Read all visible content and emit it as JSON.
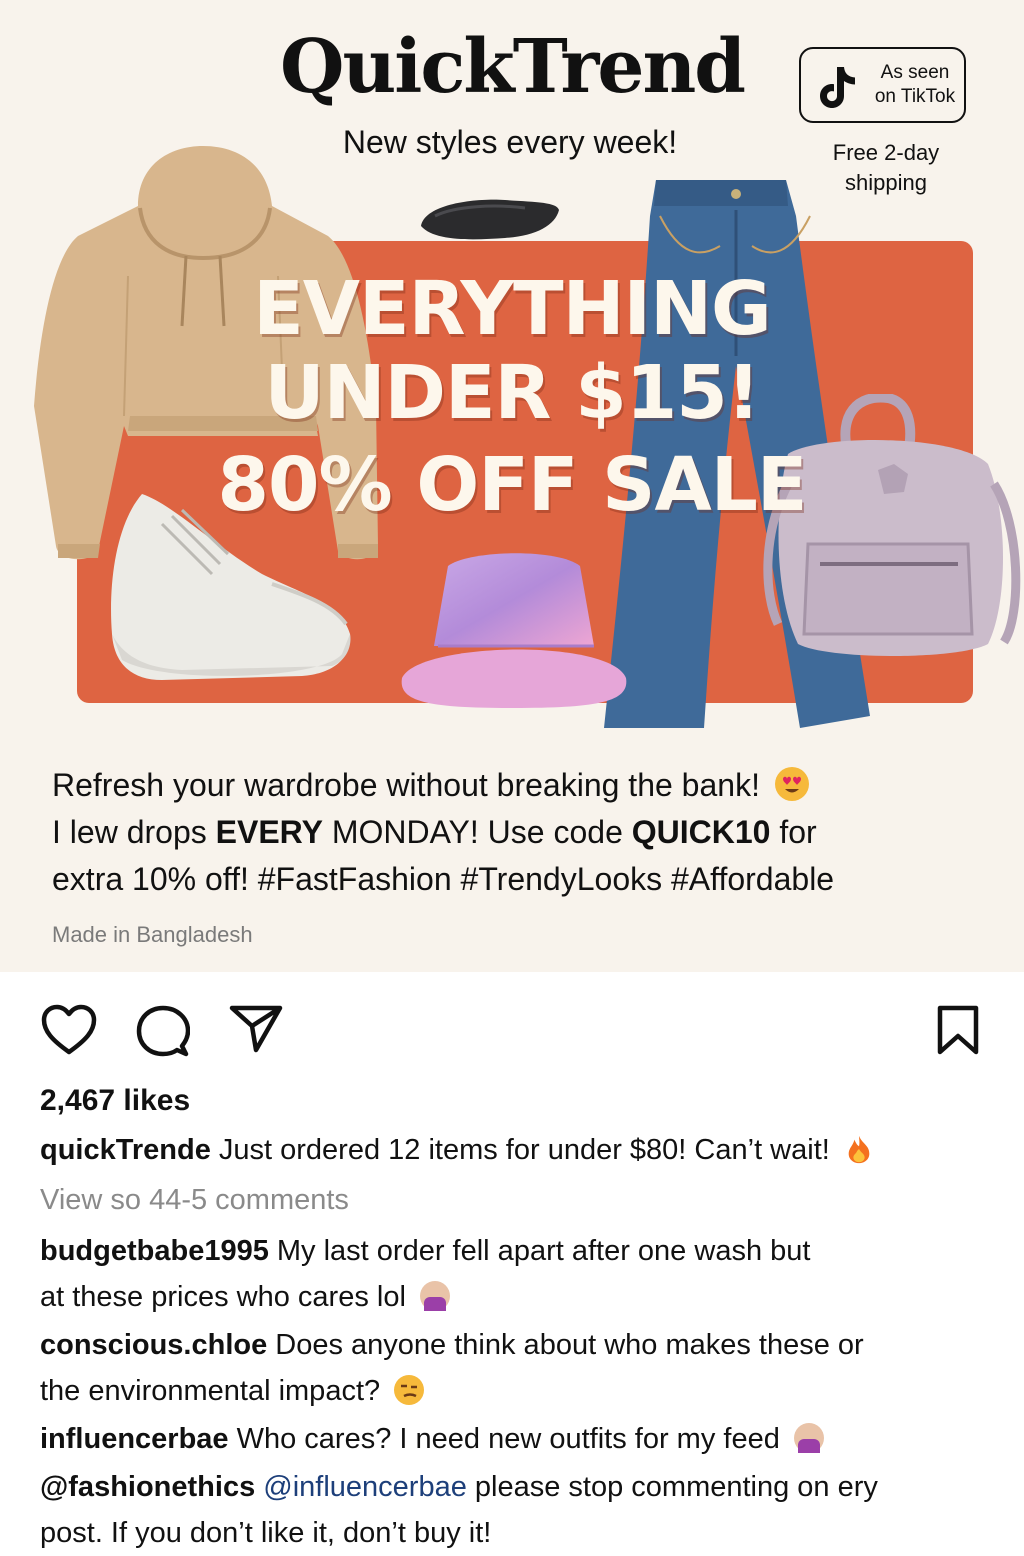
{
  "ad": {
    "brand": "QuickTrend",
    "tagline": "New styles every week!",
    "tiktok_badge": {
      "line1": "As seen",
      "line2": "on TikTok",
      "icon": "tiktok-note-icon"
    },
    "shipping": {
      "line1": "Free 2-day",
      "line2": "shipping"
    },
    "headline": {
      "line1": "EVERYTHING",
      "line2": "UNDER $15!",
      "line3": "80% OFF SALE"
    },
    "products": [
      "hoodie",
      "sunglasses",
      "jeans",
      "sneaker",
      "bucket-hat",
      "backpack"
    ],
    "colors": {
      "banner": "#de6442",
      "background": "#f8f3ec",
      "headline": "#fdf7ec"
    },
    "caption": {
      "line1": "Refresh your wardrobe without breaking the bank!",
      "line2_a": "I lew drops ",
      "line2_b": "EVERY",
      "line2_c": " MONDAY! Use code ",
      "line2_d": "QUICK10",
      "line2_e": " for",
      "line3": "extra 10% off! #FastFashion #TrendyLooks #Affordable",
      "emoji": "heart-eyes-emoji"
    },
    "made_in": "Made in Bangladesh"
  },
  "post": {
    "icons": [
      "heart-icon",
      "comment-icon",
      "share-icon",
      "bookmark-icon"
    ],
    "likes": "2,467 likes",
    "caption_user": "quickTrende",
    "caption_text": " Just ordered 12 items for under $80! Can’t wait!",
    "view_comments": "View so 44-5 comments",
    "comments": [
      {
        "user": "budgetbabe1995",
        "text": " My last order fell apart after one wash but",
        "text2": "at these prices who cares lol"
      },
      {
        "user": "conscious.chloe",
        "text": " Does anyone think about who makes these or",
        "text2": "the environmental impact?"
      },
      {
        "user": "influencerbae",
        "text": " Who cares? I need new outfits for my feed"
      },
      {
        "user": "@fashionethics",
        "mention": " @influencerbae",
        "text": " please stop commenting on ery",
        "text2": "post. If you don’t like it, don’t buy it!"
      }
    ]
  }
}
